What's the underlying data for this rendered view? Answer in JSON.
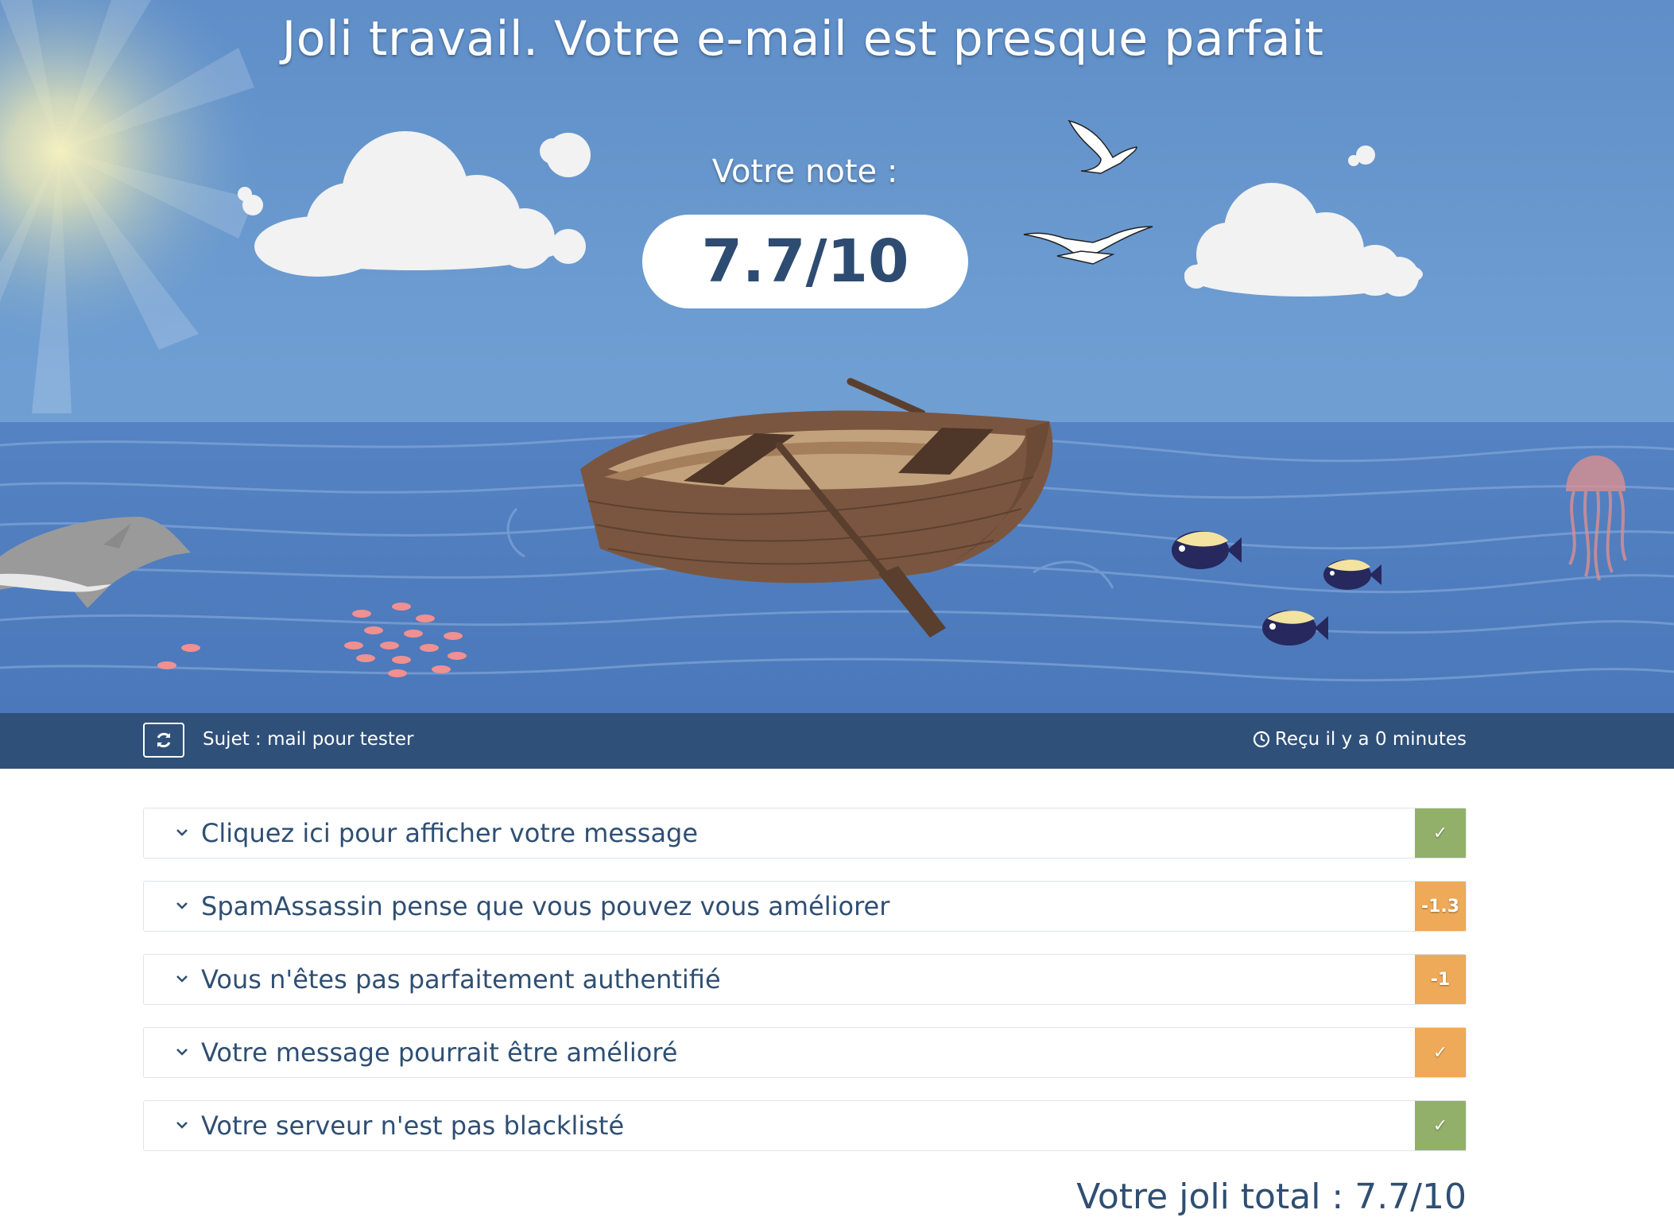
{
  "header": {
    "title": "Joli travail. Votre e-mail est presque parfait",
    "note_label": "Votre note :",
    "score": "7.7/10"
  },
  "infobar": {
    "subject": "Sujet : mail pour tester",
    "received": "Reçu il y a 0 minutes"
  },
  "sections": [
    {
      "label": "Cliquez ici pour afficher votre message",
      "badge": "✓",
      "status": "ok"
    },
    {
      "label": "SpamAssassin pense que vous pouvez vous améliorer",
      "badge": "-1.3",
      "status": "warn"
    },
    {
      "label": "Vous n'êtes pas parfaitement authentifié",
      "badge": "-1",
      "status": "warn"
    },
    {
      "label": "Votre message pourrait être amélioré",
      "badge": "✓",
      "status": "warn"
    },
    {
      "label": "Votre serveur n'est pas blacklisté",
      "badge": "✓",
      "status": "ok"
    }
  ],
  "footer": {
    "total": "Votre joli total : 7.7/10"
  },
  "colors": {
    "sky": "#6b9bd0",
    "sea": "#4f7ebf",
    "infobar": "#2f5079",
    "ok": "#93b06a",
    "warn": "#eeaa58",
    "text": "#2f4f73"
  },
  "icons": {
    "refresh": "refresh-icon",
    "clock": "clock-icon",
    "chevron": "chevron-down-icon",
    "check": "check-icon"
  }
}
